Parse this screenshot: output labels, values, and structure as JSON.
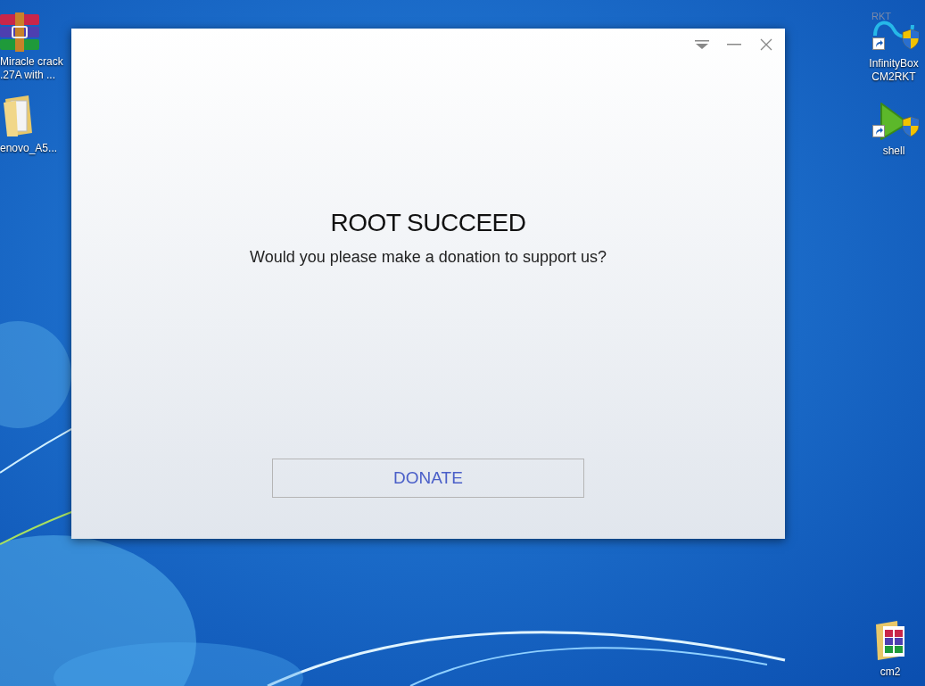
{
  "desktop_icons": [
    {
      "kind": "archive",
      "label_lines": [
        "Miracle crack",
        ".27A with ..."
      ]
    },
    {
      "kind": "folder",
      "label_lines": [
        "enovo_A5..."
      ]
    },
    {
      "kind": "infinity",
      "logo_text": "RKT",
      "shortcut": true,
      "label_lines": [
        "InfinityBox",
        "CM2RKT"
      ]
    },
    {
      "kind": "play",
      "shortcut": true,
      "label_lines": [
        "shell"
      ]
    },
    {
      "kind": "archive-folder",
      "label_lines": [
        "cm2"
      ]
    }
  ],
  "dialog": {
    "title": "ROOT SUCCEED",
    "message": "Would you please make a donation to support us?",
    "button": "DONATE"
  }
}
